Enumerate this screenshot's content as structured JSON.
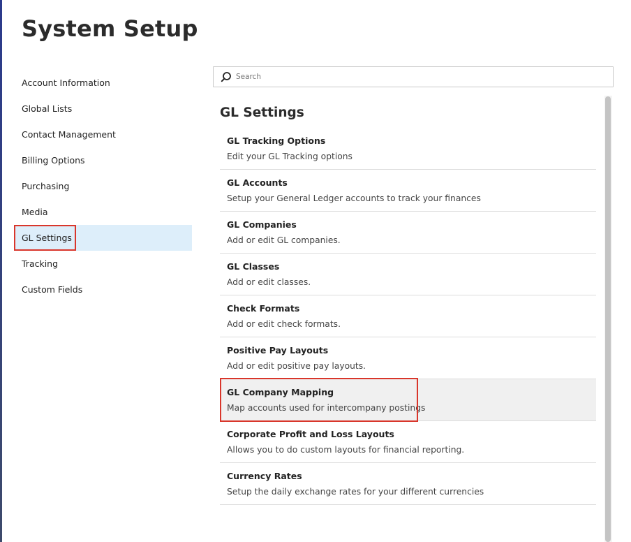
{
  "page": {
    "title": "System Setup"
  },
  "sidebar": {
    "items": [
      {
        "id": "account-information",
        "label": "Account Information",
        "active": false
      },
      {
        "id": "global-lists",
        "label": "Global Lists",
        "active": false
      },
      {
        "id": "contact-management",
        "label": "Contact Management",
        "active": false
      },
      {
        "id": "billing-options",
        "label": "Billing Options",
        "active": false
      },
      {
        "id": "purchasing",
        "label": "Purchasing",
        "active": false
      },
      {
        "id": "media",
        "label": "Media",
        "active": false
      },
      {
        "id": "gl-settings",
        "label": "GL Settings",
        "active": true
      },
      {
        "id": "tracking",
        "label": "Tracking",
        "active": false
      },
      {
        "id": "custom-fields",
        "label": "Custom Fields",
        "active": false
      }
    ]
  },
  "search": {
    "placeholder": "Search",
    "value": ""
  },
  "main": {
    "section_title": "GL Settings",
    "items": [
      {
        "id": "gl-tracking-options",
        "name": "GL Tracking Options",
        "desc": "Edit your GL Tracking options"
      },
      {
        "id": "gl-accounts",
        "name": "GL Accounts",
        "desc": "Setup your General Ledger accounts to track your finances"
      },
      {
        "id": "gl-companies",
        "name": "GL Companies",
        "desc": "Add or edit GL companies."
      },
      {
        "id": "gl-classes",
        "name": "GL Classes",
        "desc": "Add or edit classes."
      },
      {
        "id": "check-formats",
        "name": "Check Formats",
        "desc": "Add or edit check formats."
      },
      {
        "id": "positive-pay-layouts",
        "name": "Positive Pay Layouts",
        "desc": "Add or edit positive pay layouts."
      },
      {
        "id": "gl-company-mapping",
        "name": "GL Company Mapping",
        "desc": "Map accounts used for intercompany postings",
        "hovered": true
      },
      {
        "id": "corporate-profit-and-loss-layouts",
        "name": "Corporate Profit and Loss Layouts",
        "desc": "Allows you to do custom layouts for financial reporting."
      },
      {
        "id": "currency-rates",
        "name": "Currency Rates",
        "desc": "Setup the daily exchange rates for your different currencies"
      }
    ]
  },
  "colors": {
    "active_bg": "#ddeefa",
    "highlight_border": "#d9362b",
    "hover_bg": "#f0f0f0"
  }
}
